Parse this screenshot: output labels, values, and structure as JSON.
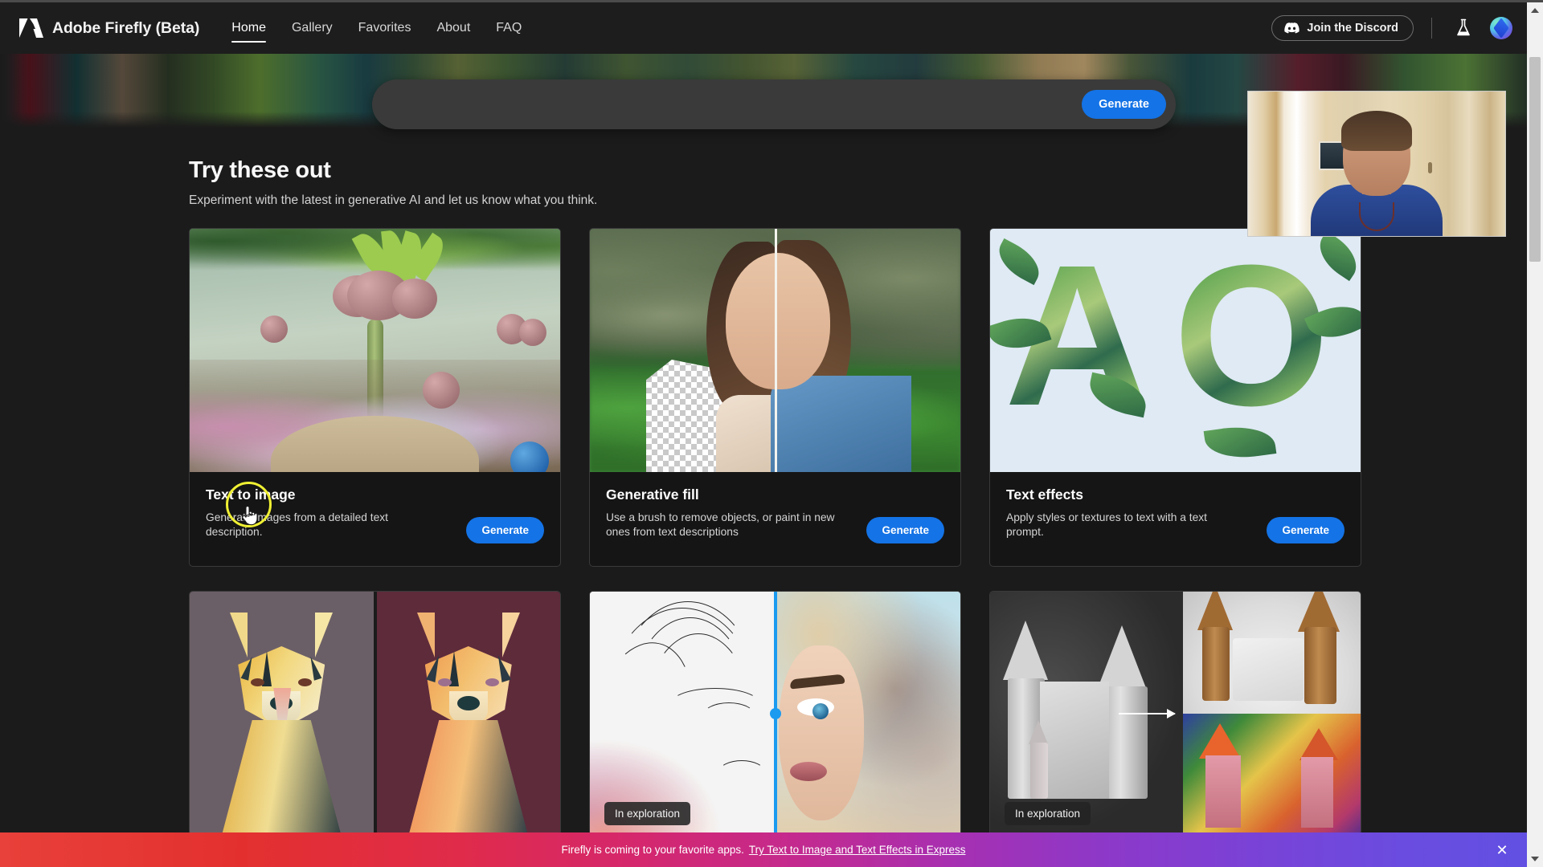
{
  "app": {
    "brand": "Adobe Firefly (Beta)",
    "logo_icon": "adobe-a-logo"
  },
  "nav": {
    "items": [
      {
        "label": "Home",
        "active": true
      },
      {
        "label": "Gallery",
        "active": false
      },
      {
        "label": "Favorites",
        "active": false
      },
      {
        "label": "About",
        "active": false
      },
      {
        "label": "FAQ",
        "active": false
      }
    ]
  },
  "header_actions": {
    "discord_label": "Join the Discord",
    "discord_icon": "discord-icon",
    "flask_icon": "flask-icon",
    "avatar_icon": "user-avatar"
  },
  "prompt": {
    "value": "",
    "placeholder": "",
    "generate_label": "Generate"
  },
  "section": {
    "title": "Try these out",
    "subtitle": "Experiment with the latest in generative AI and let us know what you think."
  },
  "cards": [
    {
      "title": "Text to image",
      "desc": "Generate images from a detailed text description.",
      "button": "Generate",
      "badge": "",
      "media": "fantasy-garden-image"
    },
    {
      "title": "Generative fill",
      "desc": "Use a brush to remove objects, or paint in new ones from text descriptions",
      "button": "Generate",
      "badge": "",
      "media": "portrait-background-fill-image"
    },
    {
      "title": "Text effects",
      "desc": "Apply styles or textures to text with a text prompt.",
      "button": "Generate",
      "badge": "",
      "media": "leafy-letters-image"
    },
    {
      "title": "",
      "desc": "",
      "button": "",
      "badge": "",
      "media": "geometric-dogs-image"
    },
    {
      "title": "",
      "desc": "",
      "button": "",
      "badge": "In exploration",
      "media": "sketch-to-portrait-image"
    },
    {
      "title": "",
      "desc": "",
      "button": "",
      "badge": "In exploration",
      "media": "3d-castle-texture-image"
    }
  ],
  "promo": {
    "text": "Firefly is coming to your favorite apps.",
    "link": "Try Text to Image and Text Effects in Express",
    "close_icon": "close-icon"
  },
  "scrollbar": {
    "up_icon": "scroll-up-arrow",
    "down_icon": "scroll-down-arrow"
  },
  "webcam": {
    "label": "webcam-overlay"
  },
  "colors": {
    "accent_blue": "#1473e6",
    "app_bg": "#1b1b1b",
    "header_bg": "#1d1d1d",
    "cursor_highlight": "#f0f033"
  }
}
